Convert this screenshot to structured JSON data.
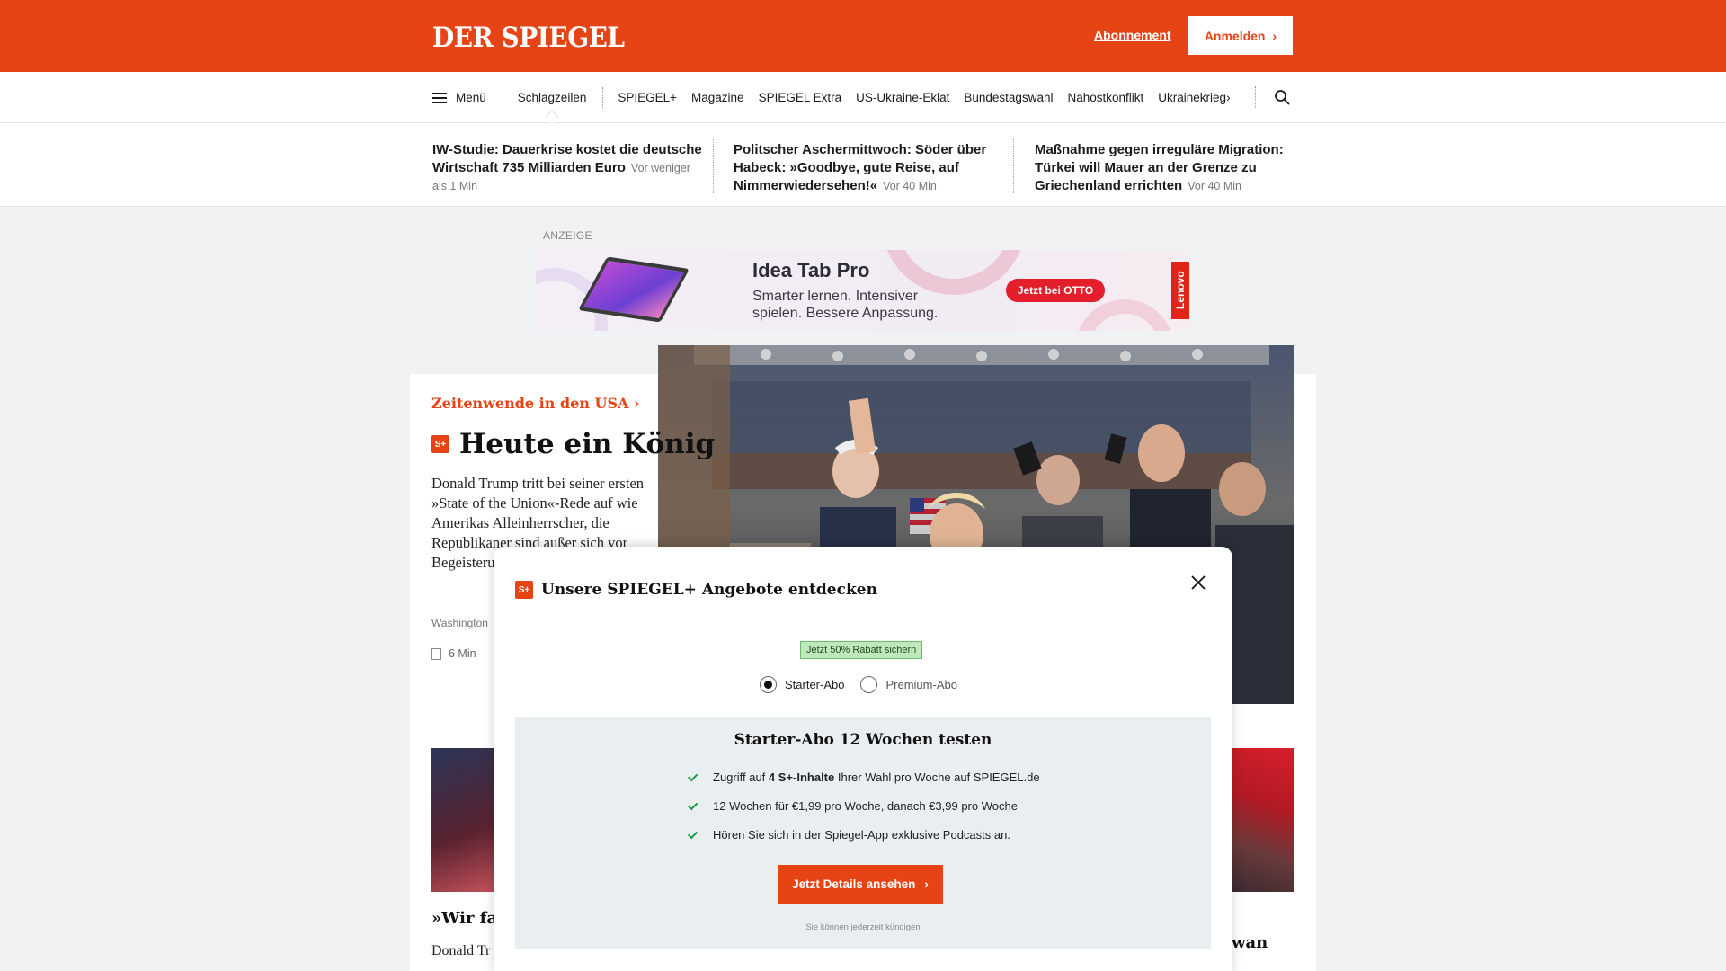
{
  "header": {
    "logo": "DER SPIEGEL",
    "subscription_link": "Abonnement",
    "login_label": "Anmelden",
    "login_chevron": "›",
    "brand_color": "#e64415"
  },
  "nav": {
    "menu_label": "Menü",
    "items": [
      "Schlagzeilen",
      "SPIEGEL+",
      "Magazine",
      "SPIEGEL Extra",
      "US-Ukraine-Eklat",
      "Bundestagswahl",
      "Nahostkonflikt",
      "Ukrainekrieg"
    ],
    "more_chevron": "›",
    "search_icon": "search-icon"
  },
  "teasers": [
    {
      "title": "IW-Studie: Dauerkrise kostet die deutsche Wirtschaft 735 Milliarden Euro",
      "time": "Vor weniger als 1 Min"
    },
    {
      "title": "Politscher Aschermittwoch: Söder über Habeck: »Goodbye, gute Reise, auf Nimmerwiedersehen!«",
      "time": "Vor 40 Min"
    },
    {
      "title": "Maßnahme gegen irreguläre Migration: Türkei will Mauer an der Grenze zu Griechenland errichten",
      "time": "Vor 40 Min"
    }
  ],
  "ad": {
    "label": "ANZEIGE",
    "title": "Idea Tab Pro",
    "subtitle": "Smarter lernen. Intensiver spielen. Bessere Anpassung.",
    "button": "Jetzt bei OTTO",
    "brand": "Lenovo"
  },
  "article": {
    "kicker": "Zeitenwende in den USA ›",
    "badge": "S+",
    "headline": "Heute ein König",
    "lead": "Donald Trump tritt bei seiner ersten »State of the Union«-Rede auf wie Amerikas Alleinherrscher, die Republikaner sind außer sich vor Begeisterung, Gassenhauer viel zu bie",
    "byline": "Washington",
    "read_time": "6 Min"
  },
  "secondary": {
    "left_title": "»Wir far",
    "left_text": "Donald Tr",
    "right_title": "wan"
  },
  "modal": {
    "badge": "S+",
    "title": "Unsere SPIEGEL+ Angebote entdecken",
    "discount": "Jetzt 50% Rabatt sichern",
    "options": [
      {
        "label": "Starter-Abo",
        "selected": true
      },
      {
        "label": "Premium-Abo",
        "selected": false
      }
    ],
    "offer_title": "Starter-Abo 12 Wochen testen",
    "features": [
      {
        "pre": "Zugriff auf ",
        "bold": "4 S+-Inhalte",
        "post": " Ihrer Wahl pro Woche auf SPIEGEL.de"
      },
      {
        "pre": "12 Wochen für €1,99 pro Woche, danach €3,99 pro Woche",
        "bold": "",
        "post": ""
      },
      {
        "pre": "Hören Sie sich in der Spiegel-App exklusive Podcasts an.",
        "bold": "",
        "post": ""
      }
    ],
    "cta": "Jetzt Details ansehen",
    "cta_chevron": "›",
    "cancel_note": "Sie können jederzeit kündigen"
  }
}
